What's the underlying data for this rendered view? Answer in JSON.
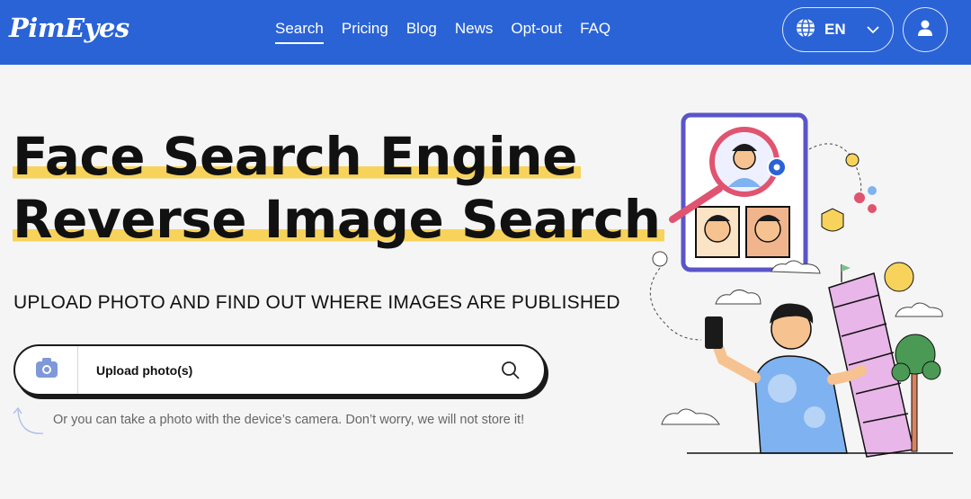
{
  "header": {
    "logo": "PimEyes",
    "nav": [
      {
        "label": "Search",
        "active": true
      },
      {
        "label": "Pricing"
      },
      {
        "label": "Blog"
      },
      {
        "label": "News"
      },
      {
        "label": "Opt-out"
      },
      {
        "label": "FAQ"
      }
    ],
    "language": "EN"
  },
  "hero": {
    "title_line1": "Face Search Engine",
    "title_line2": "Reverse Image Search",
    "subtitle": "UPLOAD PHOTO AND FIND OUT WHERE IMAGES ARE PUBLISHED",
    "upload_label": "Upload photo(s)",
    "hint": "Or you can take a photo with the device’s camera. Don’t worry, we will not store it!"
  },
  "colors": {
    "brand": "#2a63d6",
    "highlight": "#f7d35c",
    "background": "#f5f5f5"
  },
  "icons": [
    "globe-icon",
    "chevron-down-icon",
    "user-icon",
    "camera-icon",
    "search-icon",
    "curved-arrow-icon"
  ]
}
